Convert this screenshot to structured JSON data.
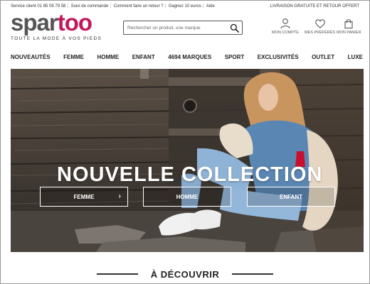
{
  "topbar": {
    "service": "Service client 01 85 09 79 58",
    "order": "Suivi de commande",
    "return": "Comment faire un retour ?",
    "win": "Gagnez 10 euros",
    "help": "Aide",
    "shipping": "LIVRAISON GRATUITE ET RETOUR OFFERT"
  },
  "logo": {
    "part1": "spar",
    "part2": "too",
    "tagline": "TOUTE LA MODE À VOS PIEDS"
  },
  "search": {
    "placeholder": "Rechercher un produit, une marque"
  },
  "account": {
    "account_label": "MON COMPTE",
    "favorites_label": "MES PRÉFÉRÉS",
    "cart_label": "MON PANIER"
  },
  "nav": [
    "NOUVEAUTÉS",
    "FEMME",
    "HOMME",
    "ENFANT",
    "4694 MARQUES",
    "SPORT",
    "EXCLUSIVITÉS",
    "OUTLET",
    "LUXE"
  ],
  "hero": {
    "headline": "NOUVELLE COLLECTION",
    "buttons": [
      "FEMME",
      "HOMME",
      "ENFANT"
    ]
  },
  "section": {
    "title": "À DÉCOUVRIR"
  },
  "colors": {
    "brand": "#c2185b",
    "logo_gray": "#555555",
    "text": "#222222"
  }
}
